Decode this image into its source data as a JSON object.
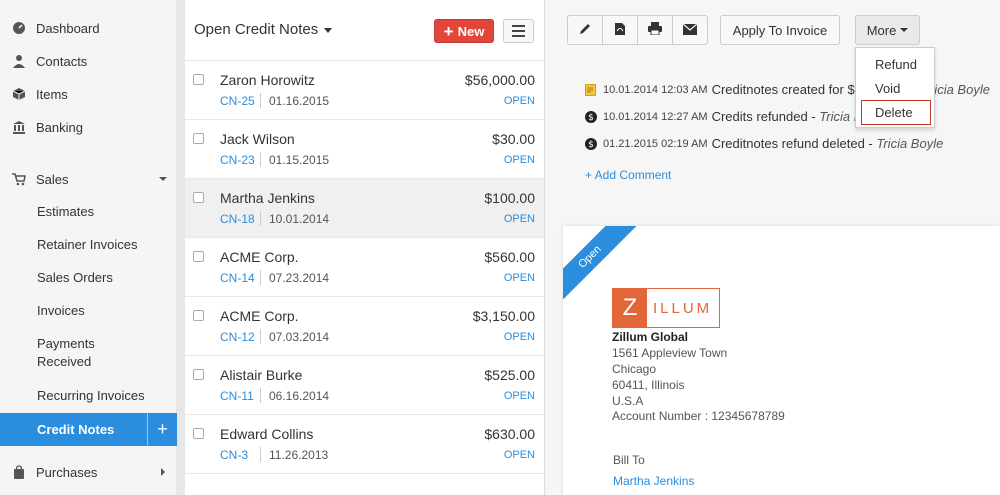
{
  "sidebar": {
    "items": [
      {
        "label": "Dashboard",
        "icon": "dashboard-icon"
      },
      {
        "label": "Contacts",
        "icon": "user-icon"
      },
      {
        "label": "Items",
        "icon": "box-icon"
      },
      {
        "label": "Banking",
        "icon": "bank-icon"
      },
      {
        "label": "Sales",
        "icon": "cart-icon"
      }
    ],
    "sales_subitems": [
      "Estimates",
      "Retainer Invoices",
      "Sales Orders",
      "Invoices",
      "Payments",
      "Received",
      "Recurring Invoices",
      "Credit Notes"
    ],
    "purchases": {
      "label": "Purchases",
      "icon": "bag-icon"
    },
    "add_symbol": "+"
  },
  "list": {
    "title": "Open Credit Notes",
    "new_label": "New",
    "rows": [
      {
        "name": "Zaron Horowitz",
        "number": "CN-25",
        "date": "01.16.2015",
        "amount": "$56,000.00",
        "status": "OPEN"
      },
      {
        "name": "Jack Wilson",
        "number": "CN-23",
        "date": "01.15.2015",
        "amount": "$30.00",
        "status": "OPEN"
      },
      {
        "name": "Martha Jenkins",
        "number": "CN-18",
        "date": "10.01.2014",
        "amount": "$100.00",
        "status": "OPEN"
      },
      {
        "name": "ACME Corp.",
        "number": "CN-14",
        "date": "07.23.2014",
        "amount": "$560.00",
        "status": "OPEN"
      },
      {
        "name": "ACME Corp.",
        "number": "CN-12",
        "date": "07.03.2014",
        "amount": "$3,150.00",
        "status": "OPEN"
      },
      {
        "name": "Alistair Burke",
        "number": "CN-11",
        "date": "06.16.2014",
        "amount": "$525.00",
        "status": "OPEN"
      },
      {
        "name": "Edward Collins",
        "number": "CN-3",
        "date": "11.26.2013",
        "amount": "$630.00",
        "status": "OPEN"
      }
    ]
  },
  "toolbar": {
    "icons": [
      "pencil-icon",
      "pdf-icon",
      "print-icon",
      "mail-icon"
    ],
    "apply_label": "Apply To Invoice",
    "more_label": "More"
  },
  "more_menu": [
    "Refund",
    "Void",
    "Delete"
  ],
  "activity": [
    {
      "time": "10.01.2014 12:03 AM",
      "text": "Creditnotes created for $10",
      "who": "Tricia Boyle",
      "icon": "note-icon"
    },
    {
      "time": "10.01.2014 12:27 AM",
      "text": "Credits refunded - ",
      "who": "Tricia Boyle",
      "icon": "dollar-icon"
    },
    {
      "time": "01.21.2015 02:19 AM",
      "text": "Creditnotes refund deleted - ",
      "who": "Tricia Boyle",
      "icon": "dollar-icon"
    }
  ],
  "add_comment": "+ Add Comment",
  "document": {
    "ribbon": "Open",
    "logo_letter": "Z",
    "logo_rest": "ILLUM",
    "org_name": "Zillum Global",
    "address": [
      "1561 Appleview Town",
      "Chicago",
      "60411, Illinois",
      "U.S.A",
      "Account Number : 12345678789"
    ],
    "bill_to_label": "Bill To",
    "bill_to_name": "Martha Jenkins"
  },
  "colors": {
    "accent": "#2b8dde",
    "new_button": "#e2463b",
    "logo": "#e2663a",
    "delete_outline": "#c0392b"
  }
}
